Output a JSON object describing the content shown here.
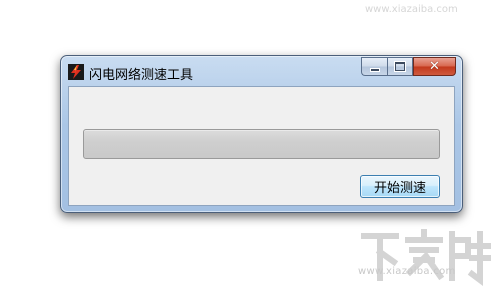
{
  "window": {
    "title": "闪电网络测速工具",
    "icon": "lightning-app-icon"
  },
  "caption": {
    "minimize_icon": "minimize-icon",
    "maximize_icon": "maximize-icon",
    "close_glyph": "✕"
  },
  "progress": {
    "value": 0
  },
  "buttons": {
    "start_label": "开始测速"
  },
  "watermark": {
    "brand": "下载吧",
    "url": "www.xiazaiba.com"
  },
  "colors": {
    "accent": "#3c7fb1",
    "close": "#c2381c"
  }
}
